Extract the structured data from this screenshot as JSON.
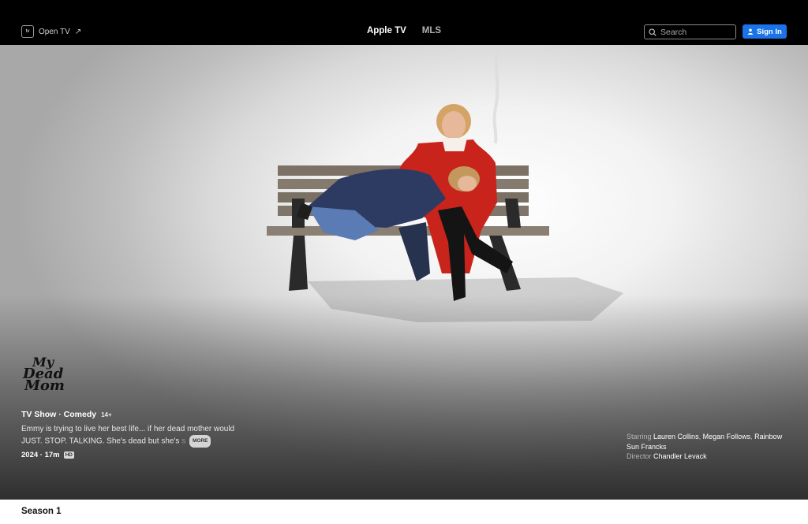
{
  "nav": {
    "open_tv_label": "Open TV",
    "open_tv_arrow": "↗",
    "logo_text": "tv",
    "links": [
      "Apple TV",
      "MLS"
    ],
    "search_placeholder": "Search",
    "signin_label": "Sign In"
  },
  "hero": {
    "show_logo_lines": [
      "My",
      "Dead",
      "Mom"
    ],
    "genre_line": "TV Show · Comedy",
    "rating": "14+",
    "description_start": "Emmy is trying to live her best life... if her dead mother would JUST. STOP. TALKING. She's dead but she's",
    "description_fade": "s",
    "more_label": "MORE",
    "year_duration": "2024 · 17m",
    "quality_badge": "HD",
    "starring_label": "Starring",
    "starring": [
      "Lauren Collins",
      "Megan Follows",
      "Rainbow Sun Francks"
    ],
    "director_label": "Director",
    "director": "Chandler Levack"
  },
  "season": {
    "title": "Season 1"
  },
  "colors": {
    "accent": "#1a73e8",
    "nav_bg": "#000000"
  }
}
